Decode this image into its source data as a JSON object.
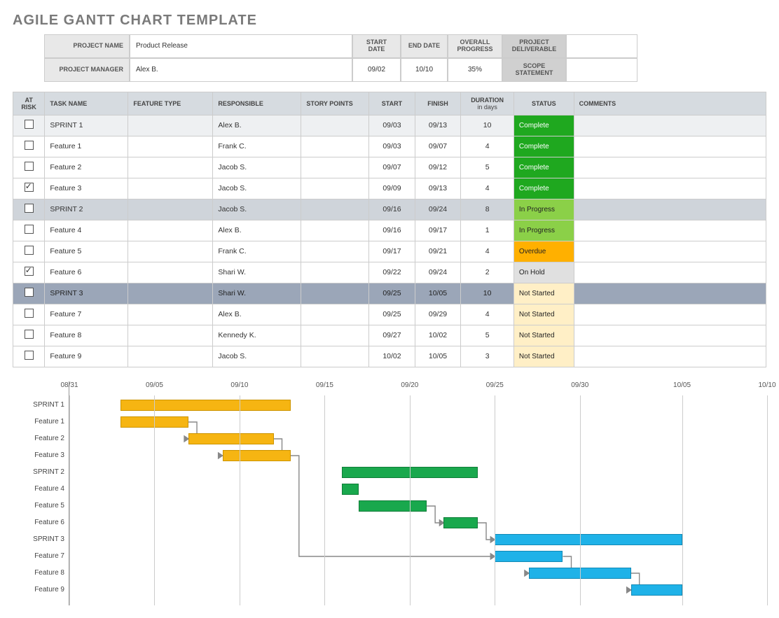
{
  "page_title": "AGILE GANTT CHART TEMPLATE",
  "meta": {
    "labels": {
      "project_name": "PROJECT NAME",
      "project_manager": "PROJECT MANAGER",
      "start_date": "START DATE",
      "end_date": "END DATE",
      "overall_progress": "OVERALL PROGRESS",
      "project_deliverable": "PROJECT DELIVERABLE",
      "scope_statement": "SCOPE STATEMENT"
    },
    "project_name": "Product Release",
    "project_manager": "Alex B.",
    "start_date": "09/02",
    "end_date": "10/10",
    "overall_progress": "35%",
    "project_deliverable": "",
    "scope_statement": ""
  },
  "columns": {
    "at_risk": "AT RISK",
    "task_name": "TASK NAME",
    "feature_type": "FEATURE TYPE",
    "responsible": "RESPONSIBLE",
    "story_points": "STORY POINTS",
    "start": "START",
    "finish": "FINISH",
    "duration": "DURATION",
    "duration_sub": "in days",
    "status": "STATUS",
    "comments": "COMMENTS"
  },
  "status_classes": {
    "Complete": "s-complete",
    "In Progress": "s-inprogress",
    "Overdue": "s-overdue",
    "On Hold": "s-onhold",
    "Not Started": "s-notstarted"
  },
  "tasks": [
    {
      "risk": false,
      "name": "SPRINT 1",
      "feature": "",
      "responsible": "Alex B.",
      "points": "",
      "start": "09/03",
      "finish": "09/13",
      "duration": "10",
      "status": "Complete",
      "comments": "",
      "row_class": "sprint-a"
    },
    {
      "risk": false,
      "name": "Feature 1",
      "feature": "",
      "responsible": "Frank C.",
      "points": "",
      "start": "09/03",
      "finish": "09/07",
      "duration": "4",
      "status": "Complete",
      "comments": "",
      "row_class": ""
    },
    {
      "risk": false,
      "name": "Feature 2",
      "feature": "",
      "responsible": "Jacob S.",
      "points": "",
      "start": "09/07",
      "finish": "09/12",
      "duration": "5",
      "status": "Complete",
      "comments": "",
      "row_class": ""
    },
    {
      "risk": true,
      "name": "Feature 3",
      "feature": "",
      "responsible": "Jacob S.",
      "points": "",
      "start": "09/09",
      "finish": "09/13",
      "duration": "4",
      "status": "Complete",
      "comments": "",
      "row_class": ""
    },
    {
      "risk": false,
      "name": "SPRINT 2",
      "feature": "",
      "responsible": "Jacob S.",
      "points": "",
      "start": "09/16",
      "finish": "09/24",
      "duration": "8",
      "status": "In Progress",
      "comments": "",
      "row_class": "sprint-b"
    },
    {
      "risk": false,
      "name": "Feature 4",
      "feature": "",
      "responsible": "Alex B.",
      "points": "",
      "start": "09/16",
      "finish": "09/17",
      "duration": "1",
      "status": "In Progress",
      "comments": "",
      "row_class": ""
    },
    {
      "risk": false,
      "name": "Feature 5",
      "feature": "",
      "responsible": "Frank C.",
      "points": "",
      "start": "09/17",
      "finish": "09/21",
      "duration": "4",
      "status": "Overdue",
      "comments": "",
      "row_class": ""
    },
    {
      "risk": true,
      "name": "Feature 6",
      "feature": "",
      "responsible": "Shari W.",
      "points": "",
      "start": "09/22",
      "finish": "09/24",
      "duration": "2",
      "status": "On Hold",
      "comments": "",
      "row_class": ""
    },
    {
      "risk": false,
      "name": "SPRINT 3",
      "feature": "",
      "responsible": "Shari W.",
      "points": "",
      "start": "09/25",
      "finish": "10/05",
      "duration": "10",
      "status": "Not Started",
      "comments": "",
      "row_class": "sprint-c"
    },
    {
      "risk": false,
      "name": "Feature 7",
      "feature": "",
      "responsible": "Alex B.",
      "points": "",
      "start": "09/25",
      "finish": "09/29",
      "duration": "4",
      "status": "Not Started",
      "comments": "",
      "row_class": ""
    },
    {
      "risk": false,
      "name": "Feature 8",
      "feature": "",
      "responsible": "Kennedy K.",
      "points": "",
      "start": "09/27",
      "finish": "10/02",
      "duration": "5",
      "status": "Not Started",
      "comments": "",
      "row_class": ""
    },
    {
      "risk": false,
      "name": "Feature 9",
      "feature": "",
      "responsible": "Jacob S.",
      "points": "",
      "start": "10/02",
      "finish": "10/05",
      "duration": "3",
      "status": "Not Started",
      "comments": "",
      "row_class": ""
    }
  ],
  "chart_data": {
    "type": "bar",
    "title": "",
    "x_axis": {
      "type": "date",
      "start": "08/31",
      "end": "10/10",
      "ticks": [
        "08/31",
        "09/05",
        "09/10",
        "09/15",
        "09/20",
        "09/25",
        "09/30",
        "10/05",
        "10/10"
      ]
    },
    "categories": [
      "SPRINT 1",
      "Feature 1",
      "Feature 2",
      "Feature 3",
      "SPRINT 2",
      "Feature 4",
      "Feature 5",
      "Feature 6",
      "SPRINT 3",
      "Feature 7",
      "Feature 8",
      "Feature 9"
    ],
    "bars": [
      {
        "name": "SPRINT 1",
        "start": "09/03",
        "end": "09/13",
        "color": "orange"
      },
      {
        "name": "Feature 1",
        "start": "09/03",
        "end": "09/07",
        "color": "orange"
      },
      {
        "name": "Feature 2",
        "start": "09/07",
        "end": "09/12",
        "color": "orange"
      },
      {
        "name": "Feature 3",
        "start": "09/09",
        "end": "09/13",
        "color": "orange"
      },
      {
        "name": "SPRINT 2",
        "start": "09/16",
        "end": "09/24",
        "color": "green"
      },
      {
        "name": "Feature 4",
        "start": "09/16",
        "end": "09/17",
        "color": "green"
      },
      {
        "name": "Feature 5",
        "start": "09/17",
        "end": "09/21",
        "color": "green"
      },
      {
        "name": "Feature 6",
        "start": "09/22",
        "end": "09/24",
        "color": "green"
      },
      {
        "name": "SPRINT 3",
        "start": "09/25",
        "end": "10/05",
        "color": "blue"
      },
      {
        "name": "Feature 7",
        "start": "09/25",
        "end": "09/29",
        "color": "blue"
      },
      {
        "name": "Feature 8",
        "start": "09/27",
        "end": "10/02",
        "color": "blue"
      },
      {
        "name": "Feature 9",
        "start": "10/02",
        "end": "10/05",
        "color": "blue"
      }
    ],
    "dependencies": [
      {
        "from": "Feature 1",
        "to": "Feature 2"
      },
      {
        "from": "Feature 2",
        "to": "Feature 3"
      },
      {
        "from": "Feature 3",
        "to": "Feature 7"
      },
      {
        "from": "Feature 5",
        "to": "Feature 6"
      },
      {
        "from": "Feature 6",
        "to": "SPRINT 3"
      },
      {
        "from": "Feature 7",
        "to": "Feature 8"
      },
      {
        "from": "Feature 8",
        "to": "Feature 9"
      }
    ],
    "color_map": {
      "orange": "#f6b512",
      "green": "#19a84d",
      "blue": "#1fb2e8"
    }
  }
}
